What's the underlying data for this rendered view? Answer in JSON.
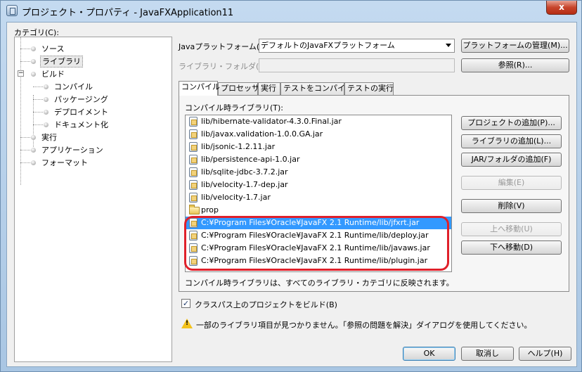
{
  "window": {
    "title": "プロジェクト・プロパティ - JavaFXApplication11",
    "close_glyph": "x"
  },
  "categories": {
    "label": "カテゴリ(C):",
    "items": [
      {
        "label": "ソース"
      },
      {
        "label": "ライブラリ",
        "selected": true
      },
      {
        "label": "ビルド",
        "expander": "−"
      },
      {
        "label": "コンパイル"
      },
      {
        "label": "パッケージング"
      },
      {
        "label": "デプロイメント"
      },
      {
        "label": "ドキュメント化"
      },
      {
        "label": "実行"
      },
      {
        "label": "アプリケーション"
      },
      {
        "label": "フォーマット"
      }
    ]
  },
  "platform": {
    "label": "Javaプラットフォーム(J):",
    "value": "デフォルトのJavaFXプラットフォーム",
    "manage_button": "プラットフォームの管理(M)..."
  },
  "library_folder": {
    "label": "ライブラリ・フォルダ(A):",
    "value": "",
    "browse_button": "参照(R)..."
  },
  "tabs": [
    {
      "label": "コンパイル",
      "active": true
    },
    {
      "label": "プロセッサ"
    },
    {
      "label": "実行"
    },
    {
      "label": "テストをコンパイル"
    },
    {
      "label": "テストの実行"
    }
  ],
  "compile_libraries": {
    "label": "コンパイル時ライブラリ(T):",
    "items": [
      {
        "text": "lib/hibernate-validator-4.3.0.Final.jar",
        "icon": "jar-icon"
      },
      {
        "text": "lib/javax.validation-1.0.0.GA.jar",
        "icon": "jar-icon"
      },
      {
        "text": "lib/jsonic-1.2.11.jar",
        "icon": "jar-icon"
      },
      {
        "text": "lib/persistence-api-1.0.jar",
        "icon": "jar-icon"
      },
      {
        "text": "lib/sqlite-jdbc-3.7.2.jar",
        "icon": "jar-icon"
      },
      {
        "text": "lib/velocity-1.7-dep.jar",
        "icon": "jar-icon"
      },
      {
        "text": "lib/velocity-1.7.jar",
        "icon": "jar-icon"
      },
      {
        "text": "prop",
        "icon": "folder-icon"
      },
      {
        "text": "C:¥Program Files¥Oracle¥JavaFX 2.1 Runtime/lib/jfxrt.jar",
        "icon": "jar-icon",
        "selected": true
      },
      {
        "text": "C:¥Program Files¥Oracle¥JavaFX 2.1 Runtime/lib/deploy.jar",
        "icon": "jar-icon"
      },
      {
        "text": "C:¥Program Files¥Oracle¥JavaFX 2.1 Runtime/lib/javaws.jar",
        "icon": "jar-icon"
      },
      {
        "text": "C:¥Program Files¥Oracle¥JavaFX 2.1 Runtime/lib/plugin.jar",
        "icon": "jar-icon"
      }
    ],
    "buttons": {
      "add_project": "プロジェクトの追加(P)...",
      "add_library": "ライブラリの追加(L)...",
      "add_jar": "JAR/フォルダの追加(F)",
      "edit": "編集(E)",
      "remove": "削除(V)",
      "move_up": "上へ移動(U)",
      "move_down": "下へ移動(D)"
    },
    "note": "コンパイル時ライブラリは、すべてのライブラリ・カテゴリに反映されます。"
  },
  "build_projects_checkbox": {
    "label": "クラスパス上のプロジェクトをビルド(B)",
    "checked": true,
    "glyph": "✓"
  },
  "warning": {
    "text": "一部のライブラリ項目が見つかりません。「参照の問題を解決」ダイアログを使用してください。",
    "mark": "!"
  },
  "footer": {
    "ok": "OK",
    "cancel": "取消し",
    "help": "ヘルプ(H)"
  }
}
